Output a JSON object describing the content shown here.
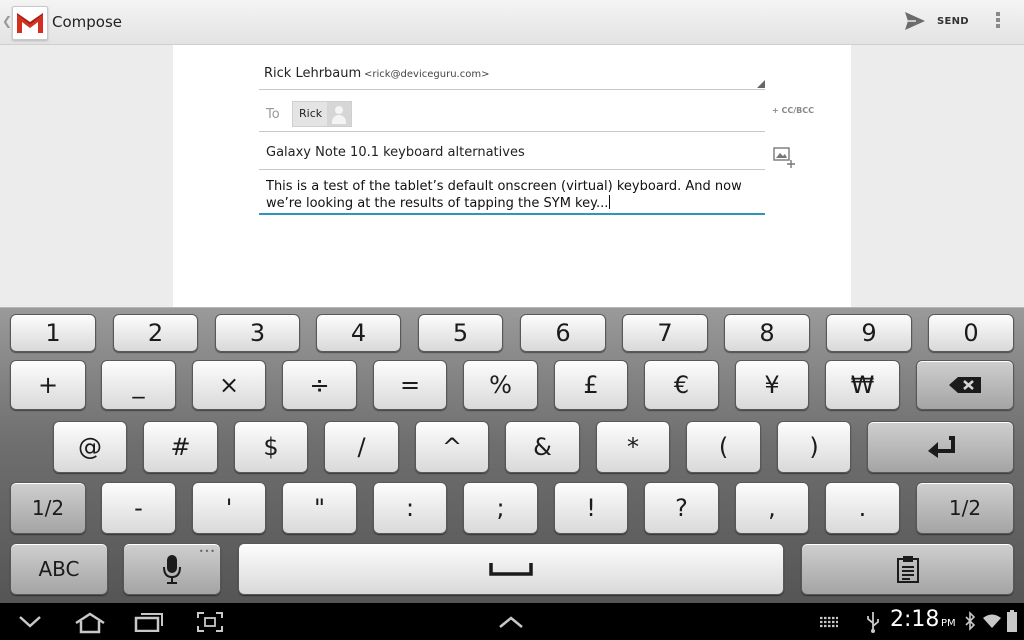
{
  "actionbar": {
    "title": "Compose",
    "send_label": "SEND",
    "app_icon": "gmail-logo-icon"
  },
  "compose": {
    "from_name": "Rick Lehrbaum",
    "from_address": "<rick@deviceguru.com>",
    "to_label": "To",
    "to_chip": "Rick",
    "cc_bcc_label": "+ CC/BCC",
    "subject": "Galaxy Note 10.1 keyboard alternatives",
    "body": "This is a test of the tablet’s default onscreen (virtual) keyboard. And now we’re looking at the results of tapping the SYM key..."
  },
  "keyboard": {
    "row1": [
      "1",
      "2",
      "3",
      "4",
      "5",
      "6",
      "7",
      "8",
      "9",
      "0"
    ],
    "row2": [
      "+",
      "_",
      "×",
      "÷",
      "=",
      "%",
      "£",
      "€",
      "¥",
      "₩"
    ],
    "row3": [
      "@",
      "#",
      "$",
      "/",
      "^",
      "&",
      "*",
      "(",
      ")"
    ],
    "row4_left": "1/2",
    "row4": [
      "-",
      "'",
      "\"",
      ":",
      ";",
      "!",
      "?",
      ",",
      "."
    ],
    "row4_right": "1/2",
    "abc_label": "ABC",
    "mic_dots": "•••"
  },
  "statusbar": {
    "time": "2:18",
    "ampm": "PM"
  },
  "colors": {
    "accent": "#2e97b8",
    "gmail_red": "#d52d1f"
  }
}
